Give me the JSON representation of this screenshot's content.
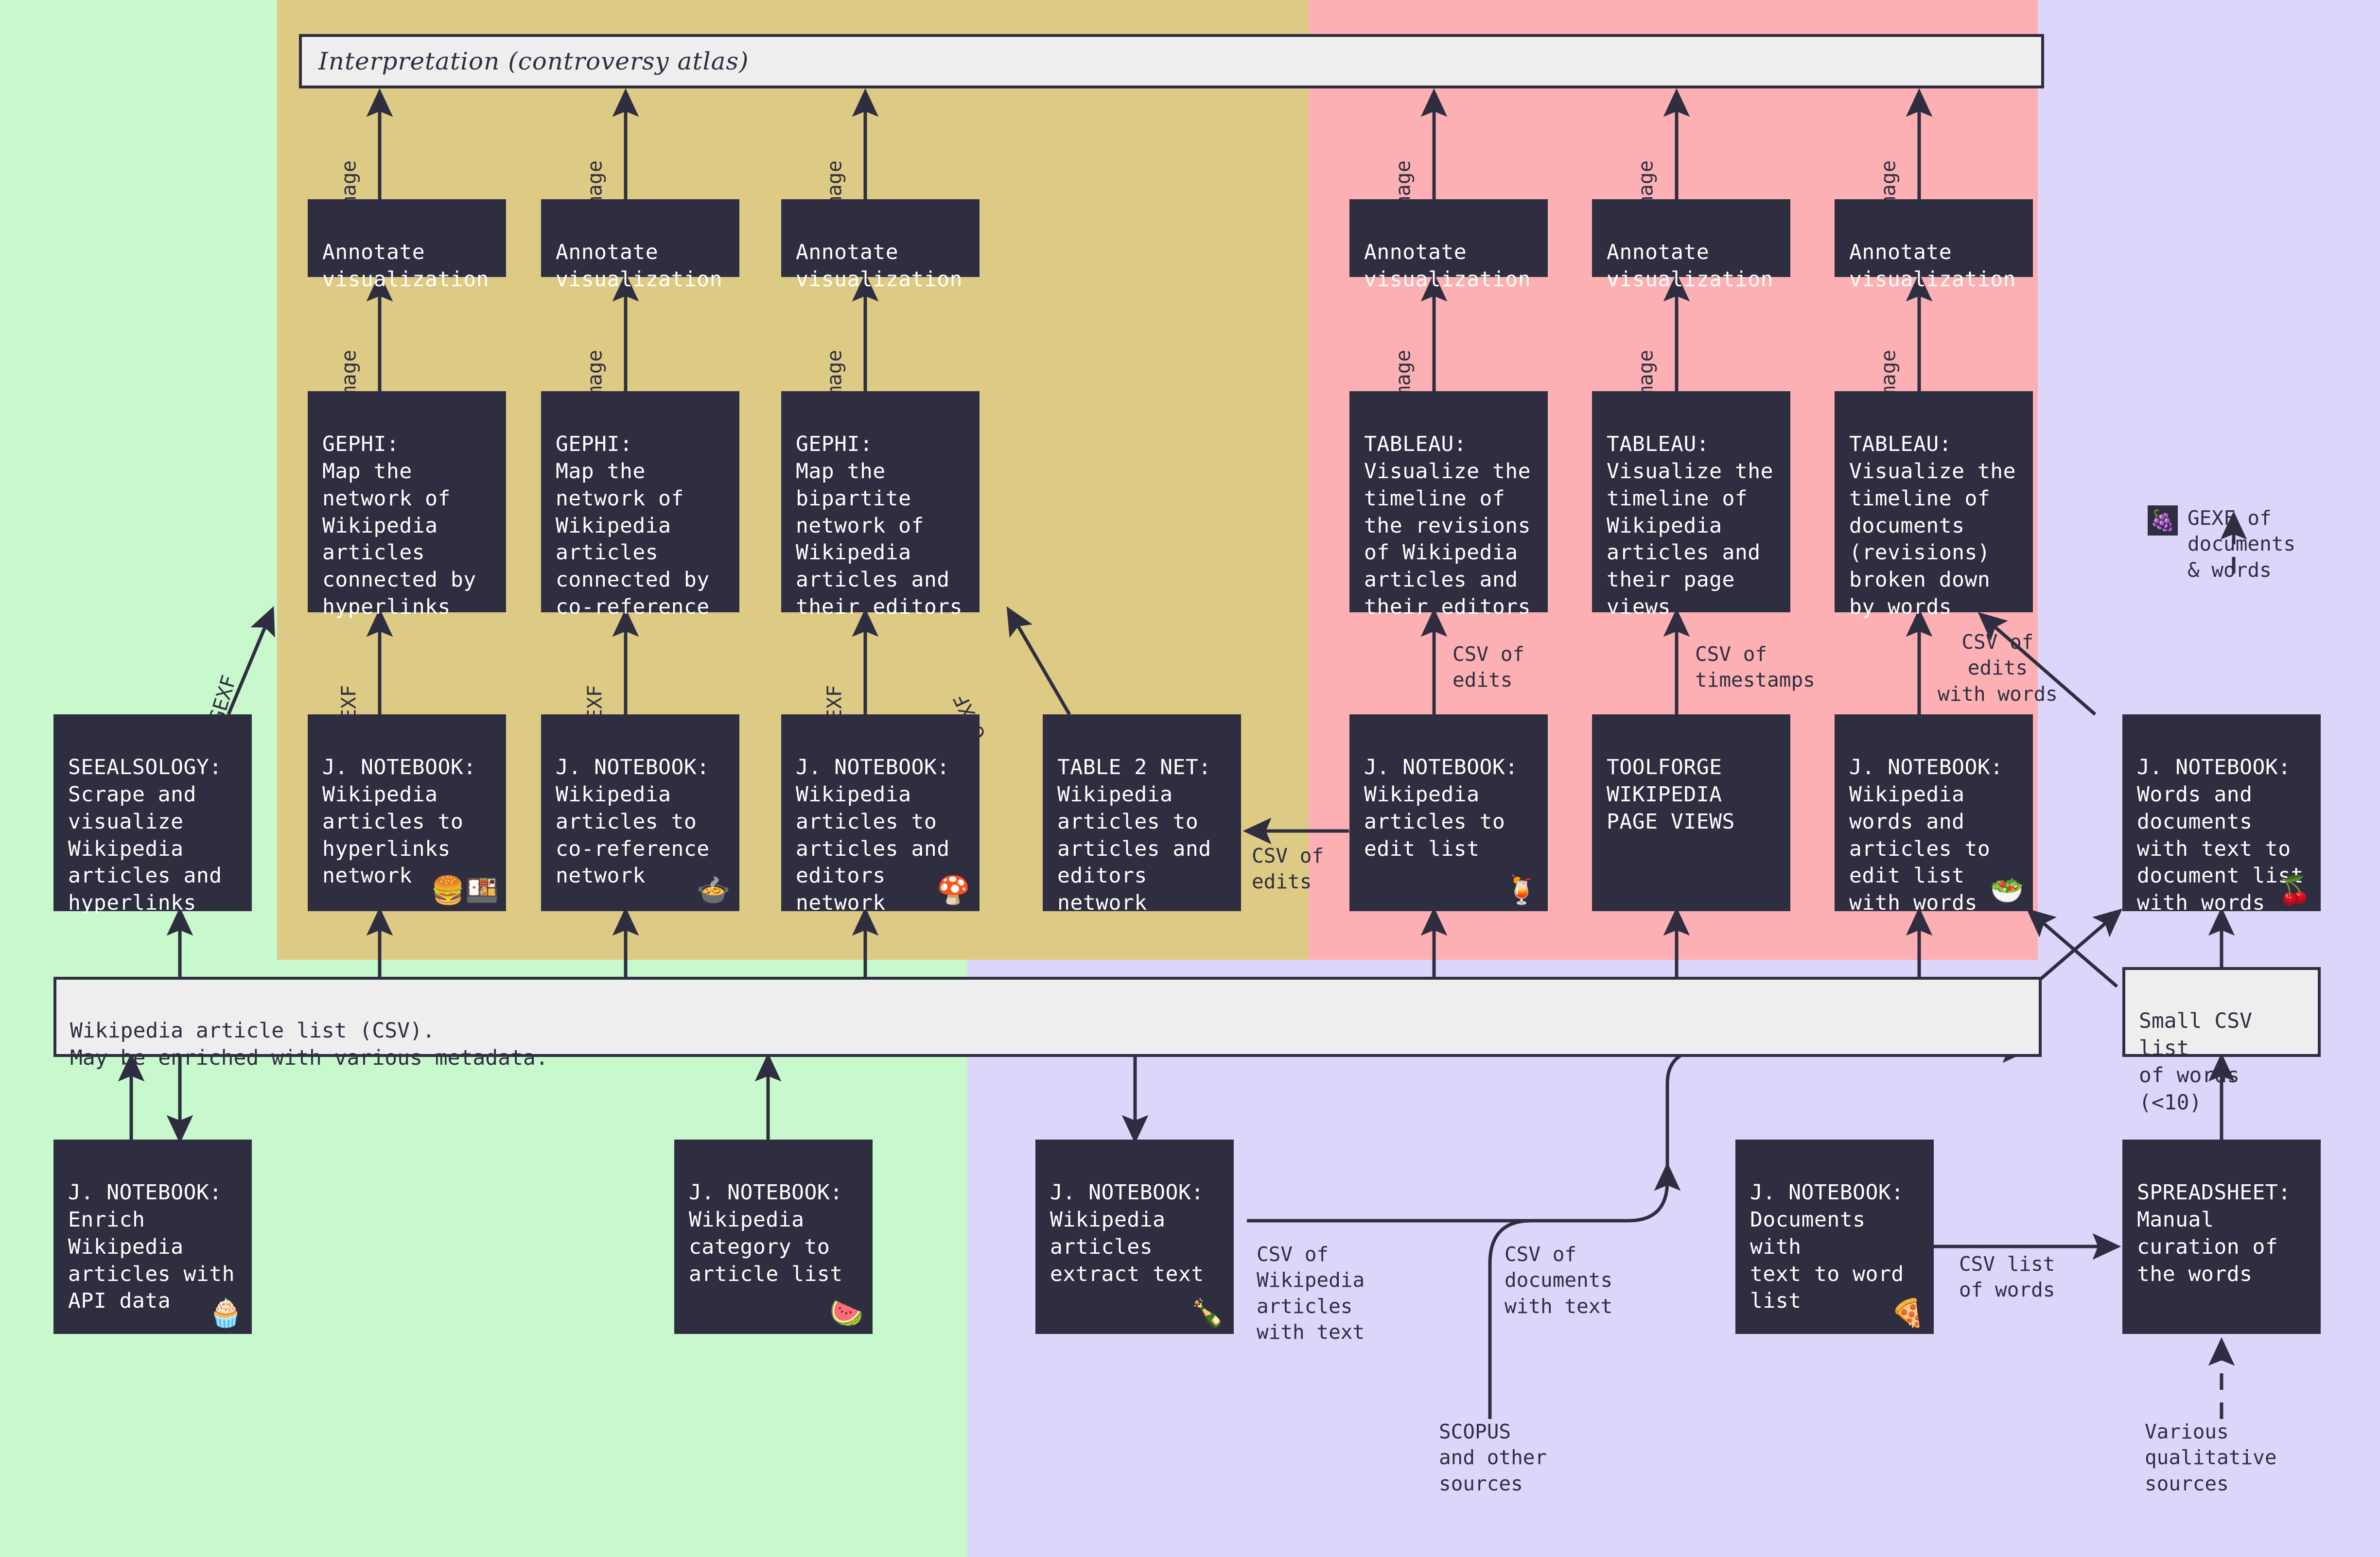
{
  "colors": {
    "green_zone": "#c7f9cc",
    "gold_zone": "#ddca84",
    "pink_zone": "#fcb0b3",
    "purple_zone": "#ddd6fb",
    "node_fill": "#2f2e41",
    "node_text": "#ffffff",
    "data_fill": "#eeeeee",
    "stroke": "#2f2e41"
  },
  "interpretation": {
    "label": "Interpretation (controversy atlas)"
  },
  "legend": {
    "icon": "grapes-icon",
    "glyph": "🍇",
    "text": "GEXF of\ndocuments\n& words"
  },
  "nodes": {
    "annotate_1": {
      "label": "Annotate\nvisualization"
    },
    "annotate_2": {
      "label": "Annotate\nvisualization"
    },
    "annotate_3": {
      "label": "Annotate\nvisualization"
    },
    "annotate_4": {
      "label": "Annotate\nvisualization"
    },
    "annotate_5": {
      "label": "Annotate\nvisualization"
    },
    "annotate_6": {
      "label": "Annotate\nvisualization"
    },
    "gephi_1": {
      "label": "GEPHI:\nMap the\nnetwork of\nWikipedia\narticles\nconnected by\nhyperlinks"
    },
    "gephi_2": {
      "label": "GEPHI:\nMap the\nnetwork of\nWikipedia\narticles\nconnected by\nco-reference"
    },
    "gephi_3": {
      "label": "GEPHI:\nMap the\nbipartite\nnetwork of\nWikipedia\narticles and\ntheir editors"
    },
    "tableau_1": {
      "label": "TABLEAU:\nVisualize the\ntimeline of\nthe revisions\nof Wikipedia\narticles and\ntheir editors"
    },
    "tableau_2": {
      "label": "TABLEAU:\nVisualize the\ntimeline of\nWikipedia\narticles and\ntheir page\nviews"
    },
    "tableau_3": {
      "label": "TABLEAU:\nVisualize the\ntimeline of\ndocuments\n(revisions)\nbroken down\nby words"
    },
    "seealsology": {
      "label": "SEEALSOLOGY:\nScrape and\nvisualize\nWikipedia\narticles and\nhyperlinks",
      "emoji": ""
    },
    "nb_hyperlinks": {
      "label": "J. NOTEBOOK:\nWikipedia\narticles to\nhyperlinks\nnetwork",
      "emoji": "🍔🍱",
      "emoji_name": "hamburger-and-bento-icon"
    },
    "nb_coreference": {
      "label": "J. NOTEBOOK:\nWikipedia\narticles to\nco-reference\nnetwork",
      "emoji": "🍲",
      "emoji_name": "pot-of-food-icon"
    },
    "nb_editors": {
      "label": "J. NOTEBOOK:\nWikipedia\narticles to\narticles and\neditors\nnetwork",
      "emoji": "🍄",
      "emoji_name": "mushroom-icon"
    },
    "table2net": {
      "label": "TABLE 2 NET:\nWikipedia\narticles to\narticles and\neditors\nnetwork",
      "emoji": ""
    },
    "nb_editlist": {
      "label": "J. NOTEBOOK:\nWikipedia\narticles to\nedit list",
      "emoji": "🍹",
      "emoji_name": "tropical-drink-icon"
    },
    "toolforge": {
      "label": "TOOLFORGE\nWIKIPEDIA\nPAGE VIEWS",
      "emoji": ""
    },
    "nb_words_editlist": {
      "label": "J. NOTEBOOK:\nWikipedia\nwords and\narticles to\nedit list\nwith words",
      "emoji": "🥗",
      "emoji_name": "green-salad-icon"
    },
    "nb_words_documents": {
      "label": "J. NOTEBOOK:\nWords and\ndocuments\nwith text to\ndocument list\nwith words",
      "emoji": "🍒",
      "emoji_name": "cherries-icon"
    },
    "nb_enrich": {
      "label": "J. NOTEBOOK:\nEnrich\nWikipedia\narticles with\nAPI data",
      "emoji": "🧁",
      "emoji_name": "cupcake-icon"
    },
    "nb_category": {
      "label": "J. NOTEBOOK:\nWikipedia\ncategory to\narticle list",
      "emoji": "🍉",
      "emoji_name": "watermelon-icon"
    },
    "nb_extract_text": {
      "label": "J. NOTEBOOK:\nWikipedia\narticles\nextract text",
      "emoji": "🍾",
      "emoji_name": "champagne-bottle-icon"
    },
    "nb_doc_wordlist": {
      "label": "J. NOTEBOOK:\nDocuments with\ntext to word\nlist",
      "emoji": "🍕",
      "emoji_name": "pizza-icon"
    },
    "spreadsheet": {
      "label": "SPREADSHEET:\nManual\ncuration of\nthe words",
      "emoji": ""
    }
  },
  "data_boxes": {
    "article_list": {
      "label": "Wikipedia article list (CSV).\nMay be enriched with various metadata."
    },
    "small_csv_words": {
      "label": "Small CSV list\nof words (<10)"
    }
  },
  "edge_labels": {
    "image_1": "Image",
    "image_2": "Image",
    "image_3": "Image",
    "image_4": "Image",
    "image_5": "Image",
    "image_6": "Image",
    "image_7": "Image",
    "image_8": "Image",
    "image_9": "Image",
    "image_10": "Image",
    "image_11": "Image",
    "image_12": "Image",
    "gexf_1": "GEXF",
    "gexf_2": "GEXF",
    "gexf_3": "GEXF",
    "gexf_4": "GEXF",
    "gexf_5": "GEXF",
    "csv_of_edits_left": "CSV of\nedits",
    "csv_of_edits_up": "CSV of\nedits",
    "csv_of_timestamps": "CSV of\ntimestamps",
    "csv_of_edits_with_words": "CSV of\nedits\nwith words",
    "csv_wiki_articles_text": "CSV of\nWikipedia\narticles\nwith text",
    "csv_documents_text": "CSV of\ndocuments\nwith text",
    "csv_list_of_words": "CSV list\nof words",
    "scopus": "SCOPUS\nand other\nsources",
    "qualitative": "Various\nqualitative\nsources"
  }
}
